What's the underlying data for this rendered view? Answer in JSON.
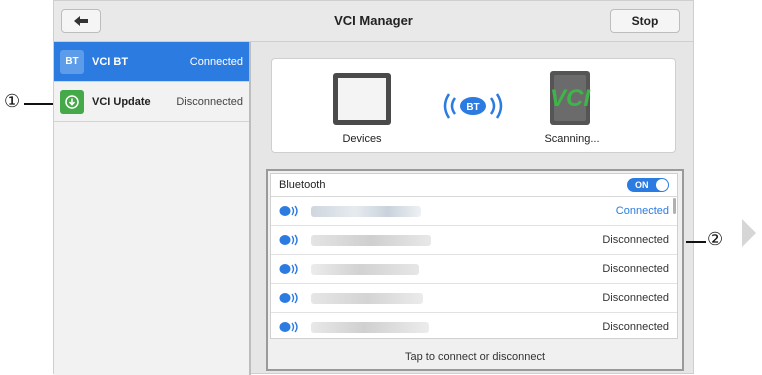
{
  "header": {
    "title": "VCI Manager",
    "stop_label": "Stop"
  },
  "sidebar": {
    "items": [
      {
        "icon_text": "BT",
        "label": "VCI BT",
        "status": "Connected"
      },
      {
        "label": "VCI Update",
        "status": "Disconnected"
      }
    ]
  },
  "diagram": {
    "devices_label": "Devices",
    "vci_logo_text": "VCI",
    "bt_badge_text": "BT",
    "scanning_label": "Scanning..."
  },
  "bluetooth": {
    "label": "Bluetooth",
    "toggle_text": "ON",
    "devices": [
      {
        "status": "Connected"
      },
      {
        "status": "Disconnected"
      },
      {
        "status": "Disconnected"
      },
      {
        "status": "Disconnected"
      },
      {
        "status": "Disconnected"
      }
    ],
    "footer": "Tap to connect or disconnect"
  },
  "callouts": {
    "one": "①",
    "two": "②"
  },
  "colors": {
    "accent": "#2c7be0",
    "vci_green": "#3fb449"
  }
}
